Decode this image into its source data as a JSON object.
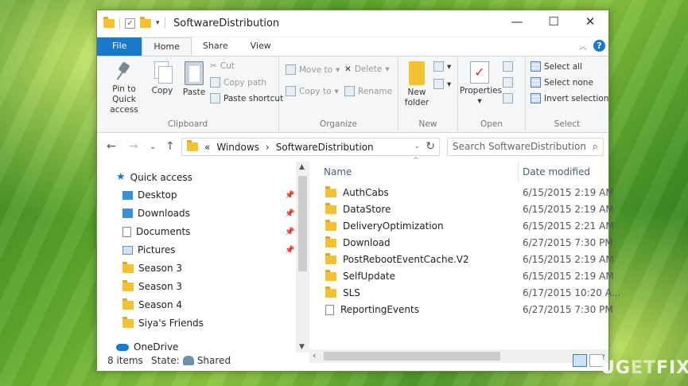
{
  "window": {
    "title": "SoftwareDistribution",
    "controls": {
      "minimize": "—",
      "maximize": "☐",
      "close": "✕"
    }
  },
  "tabs": [
    {
      "label": "File"
    },
    {
      "label": "Home"
    },
    {
      "label": "Share"
    },
    {
      "label": "View"
    }
  ],
  "ribbon": {
    "clipboard": {
      "label": "Clipboard",
      "pin_line1": "Pin to Quick",
      "pin_line2": "access",
      "copy": "Copy",
      "paste": "Paste",
      "cut": "Cut",
      "copy_path": "Copy path",
      "paste_shortcut": "Paste shortcut"
    },
    "organize": {
      "label": "Organize",
      "move_to": "Move to",
      "copy_to": "Copy to",
      "delete": "Delete",
      "rename": "Rename"
    },
    "new": {
      "label": "New",
      "new_folder_line1": "New",
      "new_folder_line2": "folder"
    },
    "open": {
      "label": "Open",
      "properties": "Properties"
    },
    "select": {
      "label": "Select",
      "select_all": "Select all",
      "select_none": "Select none",
      "invert_selection": "Invert selection"
    }
  },
  "address": {
    "overflow": "«",
    "crumbs": [
      "Windows",
      "SoftwareDistribution"
    ],
    "separator": "›",
    "search_placeholder": "Search SoftwareDistribution"
  },
  "nav": {
    "quick_access": "Quick access",
    "items": [
      {
        "label": "Desktop"
      },
      {
        "label": "Downloads"
      },
      {
        "label": "Documents"
      },
      {
        "label": "Pictures"
      },
      {
        "label": "Season 3"
      },
      {
        "label": "Season 3"
      },
      {
        "label": "Season 4"
      },
      {
        "label": "Siya's Friends"
      }
    ],
    "onedrive": "OneDrive"
  },
  "columns": {
    "name": "Name",
    "date": "Date modified"
  },
  "files": [
    {
      "name": "AuthCabs",
      "date": "6/15/2015 2:19 AM",
      "type": "folder"
    },
    {
      "name": "DataStore",
      "date": "6/15/2015 2:19 AM",
      "type": "folder"
    },
    {
      "name": "DeliveryOptimization",
      "date": "6/15/2015 2:21 AM",
      "type": "folder"
    },
    {
      "name": "Download",
      "date": "6/27/2015 7:30 PM",
      "type": "folder"
    },
    {
      "name": "PostRebootEventCache.V2",
      "date": "6/15/2015 2:19 AM",
      "type": "folder"
    },
    {
      "name": "SelfUpdate",
      "date": "6/15/2015 2:19 AM",
      "type": "folder"
    },
    {
      "name": "SLS",
      "date": "6/17/2015 10:20 A...",
      "type": "folder"
    },
    {
      "name": "ReportingEvents",
      "date": "6/27/2015 7:30 PM",
      "type": "file"
    }
  ],
  "status": {
    "count": "8 items",
    "state_label": "State:",
    "state_value": "Shared"
  },
  "watermark": {
    "left": "UG",
    "mid": "ET",
    "right": "FIX"
  },
  "colors": {
    "accent": "#1979ca",
    "folder": "#f1c232",
    "wallpaper": "#5aa52c"
  }
}
